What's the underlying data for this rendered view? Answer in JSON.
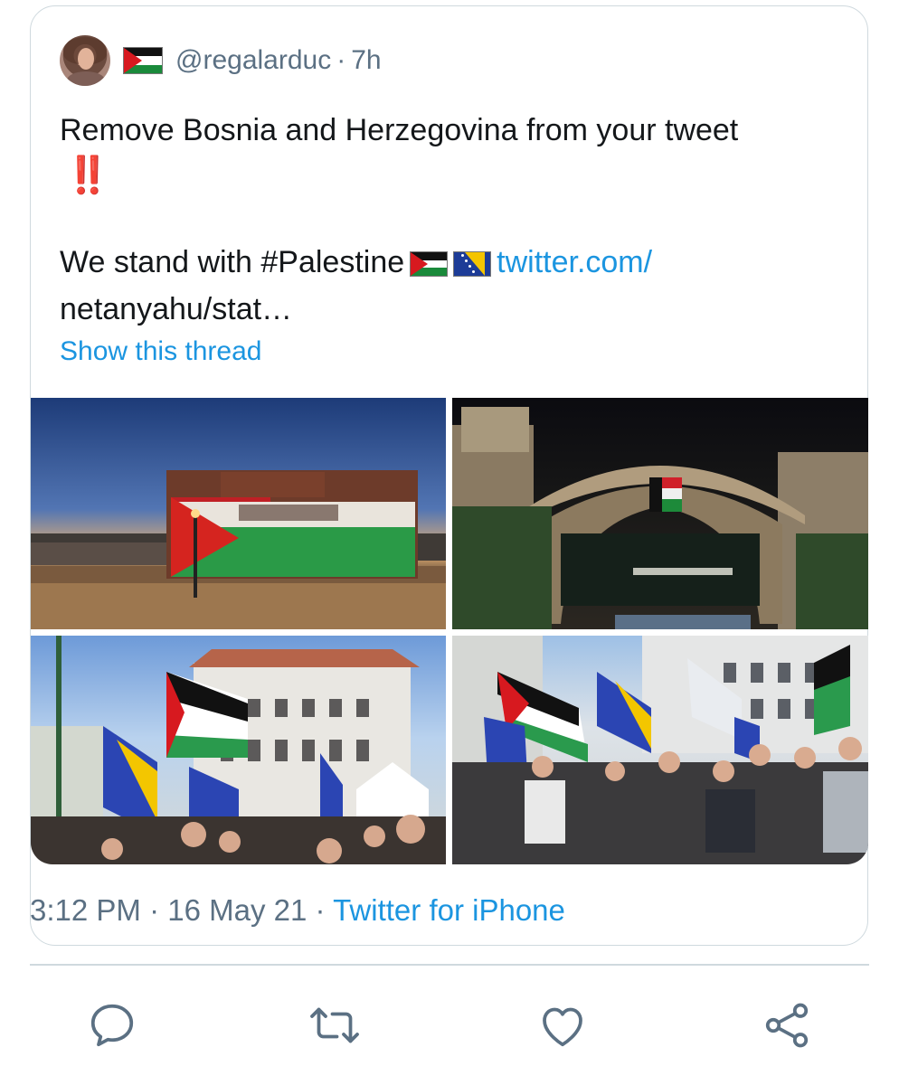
{
  "tweet": {
    "handle": "@regalarduc",
    "separator": "·",
    "age": "7h",
    "line1": "Remove Bosnia and Herzegovina from your tweet",
    "emphasis": "‼️",
    "line2_prefix": "We stand with #Palestine",
    "link_part1": "twitter.com/",
    "link_part2": "netanyahu/stat…",
    "show_thread": "Show this thread",
    "meta": {
      "time": "3:12 PM",
      "sep": "·",
      "date": "16 May 21",
      "sep2": "·",
      "source": "Twitter for iPhone"
    }
  },
  "media": [
    {
      "subject": "building lit with Palestinian flag colors at dusk"
    },
    {
      "subject": "old stone arch bridge at night with Palestinian flag"
    },
    {
      "subject": "crowd with Palestinian and Bosnian flags in front of building"
    },
    {
      "subject": "march with Palestinian and Bosnian flags"
    }
  ],
  "actions": [
    {
      "icon": "reply-icon"
    },
    {
      "icon": "retweet-icon"
    },
    {
      "icon": "like-icon"
    },
    {
      "icon": "share-icon"
    }
  ],
  "colors": {
    "link": "#1b95e0",
    "muted": "#5b7083",
    "text": "#14171a",
    "border": "#cfd9de"
  }
}
